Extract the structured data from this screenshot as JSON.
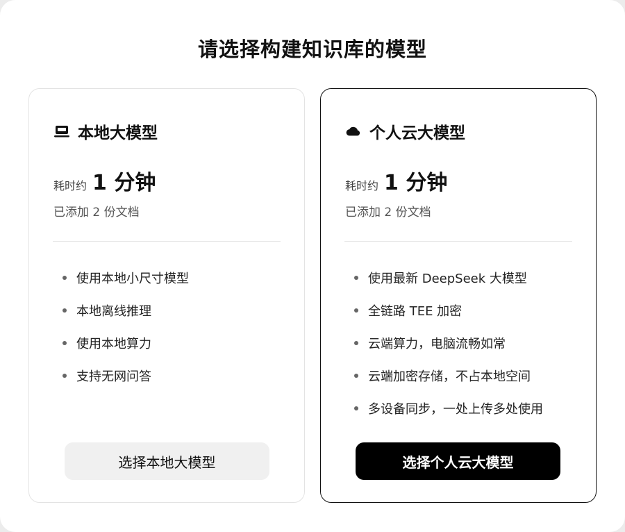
{
  "dialog": {
    "title": "请选择构建知识库的模型"
  },
  "cards": [
    {
      "icon": "laptop-icon",
      "name": "本地大模型",
      "time_prefix": "耗时约",
      "time_value": "1 分钟",
      "docs_added": "已添加 2 份文档",
      "features": [
        "使用本地小尺寸模型",
        "本地离线推理",
        "使用本地算力",
        "支持无网问答"
      ],
      "button_label": "选择本地大模型",
      "selected": false
    },
    {
      "icon": "cloud-icon",
      "name": "个人云大模型",
      "time_prefix": "耗时约",
      "time_value": "1 分钟",
      "docs_added": "已添加 2 份文档",
      "features": [
        "使用最新 DeepSeek 大模型",
        "全链路 TEE 加密",
        "云端算力，电脑流畅如常",
        "云端加密存储，不占本地空间",
        "多设备同步，一处上传多处使用"
      ],
      "button_label": "选择个人云大模型",
      "selected": true
    }
  ],
  "colors": {
    "accent": "#000000",
    "card_border_selected": "#111111",
    "card_border_default": "#e3e3e3",
    "secondary_button_bg": "#f0f0f0"
  }
}
